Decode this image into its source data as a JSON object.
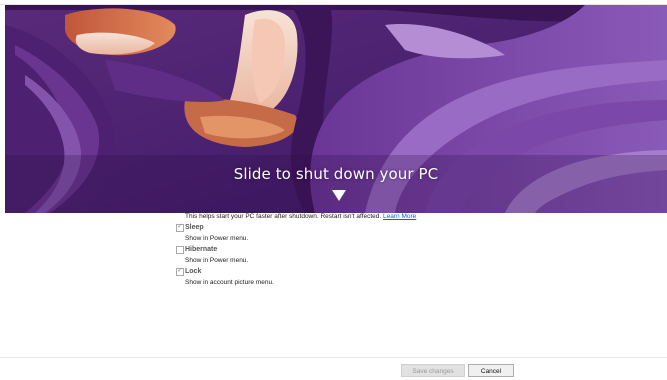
{
  "overlay": {
    "slide_text": "Slide to shut down your PC",
    "arrow_icon": "down-arrow-icon"
  },
  "settings": {
    "fast_startup_hint": "This helps start your PC faster after shutdown. Restart isn't affected.",
    "learn_more_link": "Learn More",
    "options": [
      {
        "label": "Sleep",
        "checked": true,
        "description": "Show in Power menu."
      },
      {
        "label": "Hibernate",
        "checked": false,
        "description": "Show in Power menu."
      },
      {
        "label": "Lock",
        "checked": true,
        "description": "Show in account picture menu."
      }
    ]
  },
  "footer": {
    "save_label": "Save changes",
    "cancel_label": "Cancel"
  }
}
